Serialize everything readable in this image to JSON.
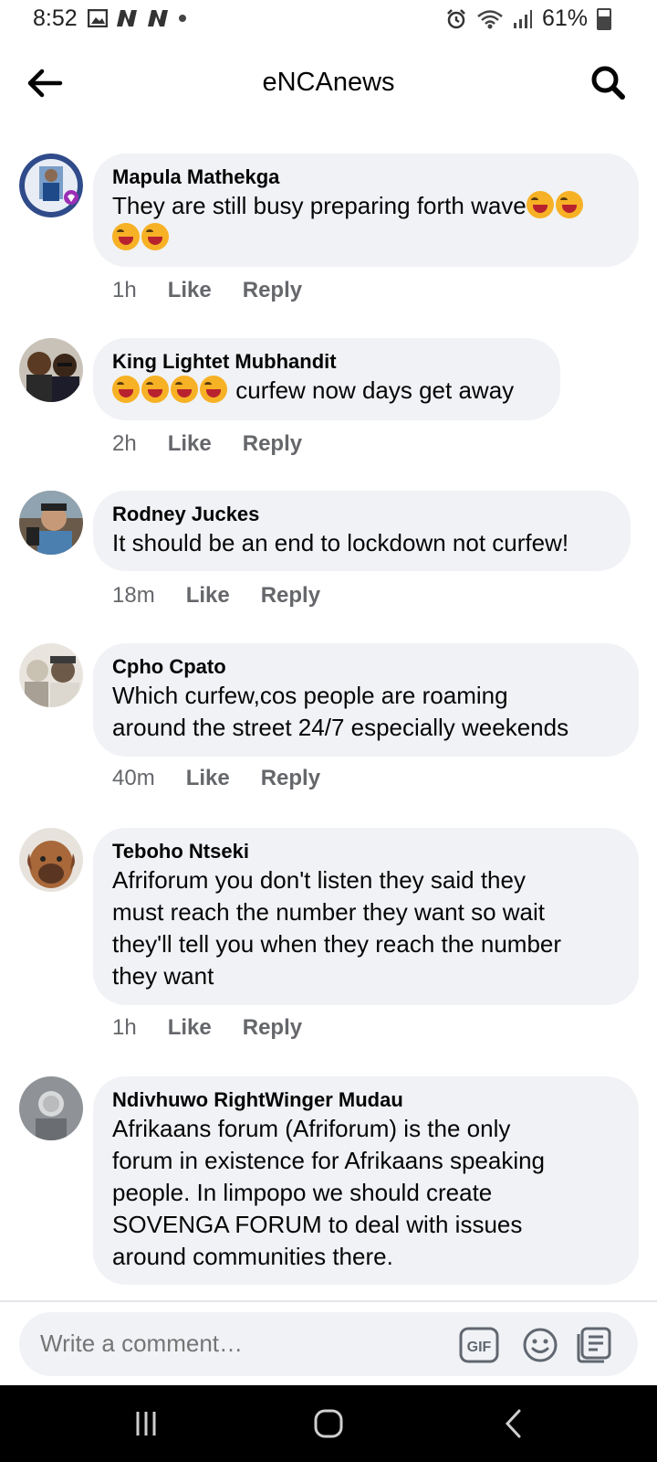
{
  "status_bar": {
    "time": "8:52",
    "battery": "61%",
    "battery_level": 0.61,
    "left_icons": [
      "image-icon",
      "n-icon",
      "n-icon",
      "dot-icon"
    ],
    "right_icons": [
      "alarm-icon",
      "wifi-icon",
      "signal-icon",
      "battery-icon"
    ]
  },
  "header": {
    "title": "eNCAnews"
  },
  "comments": [
    {
      "author": "Mapula Mathekga",
      "text_lines": [
        "They are still busy preparing forth wave"
      ],
      "emoji_trailing": 4,
      "time": "1h",
      "like": "Like",
      "reply": "Reply"
    },
    {
      "author": "King Lightet Mubhandit",
      "emoji_leading": 4,
      "text": "curfew now days get away",
      "time": "2h",
      "like": "Like",
      "reply": "Reply"
    },
    {
      "author": "Rodney Juckes",
      "text": "It should be an end to lockdown not curfew!",
      "time": "18m",
      "like": "Like",
      "reply": "Reply"
    },
    {
      "author": "Cpho Cpato",
      "text_lines": [
        "Which curfew,cos people are roaming",
        "around the street 24/7 especially weekends"
      ],
      "time": "40m",
      "like": "Like",
      "reply": "Reply"
    },
    {
      "author": "Teboho Ntseki",
      "text_lines": [
        "Afriforum you don't listen they said they",
        "must reach the number they want so wait",
        "they'll tell you when they reach the number",
        "they want"
      ],
      "time": "1h",
      "like": "Like",
      "reply": "Reply"
    },
    {
      "author": "Ndivhuwo RightWinger Mudau",
      "text_lines": [
        "Afrikaans forum (Afriforum) is the only",
        "forum in existence for Afrikaans speaking",
        "people. In limpopo we should create",
        "SOVENGA FORUM to deal with issues",
        "around communities there."
      ]
    }
  ],
  "composer": {
    "placeholder": "Write a comment…",
    "gif_label": "GIF"
  },
  "colors": {
    "bubble": "#f0f2f5",
    "meta": "#65676b",
    "text": "#050505"
  }
}
